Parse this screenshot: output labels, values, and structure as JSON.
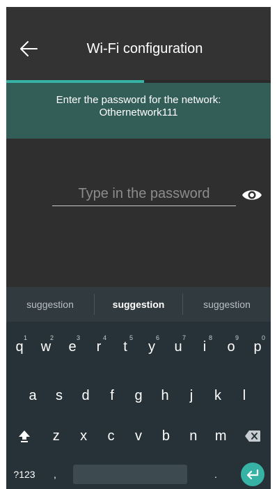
{
  "app_bar": {
    "title": "Wi-Fi configuration",
    "back_icon": "arrow-left-icon",
    "progress_fraction": 0.52
  },
  "banner": {
    "line1": "Enter the password for the network:",
    "line2": "Othernetwork111"
  },
  "password": {
    "placeholder": "Type in the password",
    "value": "",
    "toggle_icon": "eye-icon"
  },
  "keyboard": {
    "suggestions": [
      "suggestion",
      "suggestion",
      "suggestion"
    ],
    "row1": [
      {
        "key": "q",
        "hint": "1"
      },
      {
        "key": "w",
        "hint": "2"
      },
      {
        "key": "e",
        "hint": "3"
      },
      {
        "key": "r",
        "hint": "4"
      },
      {
        "key": "t",
        "hint": "5"
      },
      {
        "key": "y",
        "hint": "6"
      },
      {
        "key": "u",
        "hint": "7"
      },
      {
        "key": "i",
        "hint": "8"
      },
      {
        "key": "o",
        "hint": "9"
      },
      {
        "key": "p",
        "hint": "0"
      }
    ],
    "row2": [
      "a",
      "s",
      "d",
      "f",
      "g",
      "h",
      "j",
      "k",
      "l"
    ],
    "row3": [
      "z",
      "x",
      "c",
      "v",
      "b",
      "n",
      "m"
    ],
    "symbols_label": "?123",
    "comma_label": ",",
    "period_label": ".",
    "shift_icon": "shift-icon",
    "backspace_icon": "backspace-icon",
    "enter_icon": "enter-icon"
  },
  "colors": {
    "accent": "#36b3a5",
    "banner_bg": "#335e58",
    "screen_bg": "#2f2f2f",
    "keyboard_bg": "#263238"
  }
}
